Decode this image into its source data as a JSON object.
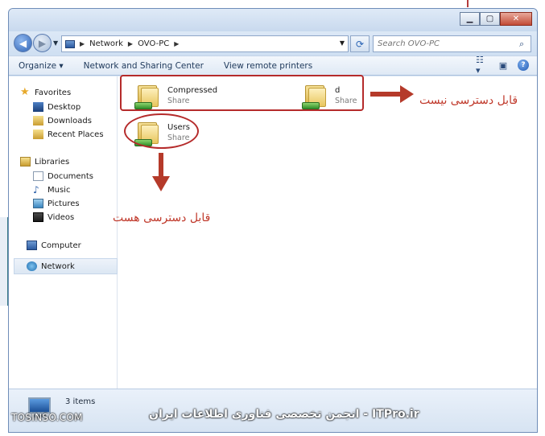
{
  "address": {
    "crumbs": [
      "Network",
      "OVO-PC"
    ]
  },
  "search": {
    "placeholder": "Search OVO-PC"
  },
  "toolbar": {
    "organize_label": "Organize ▾",
    "network_sharing_label": "Network and Sharing Center",
    "view_printers_label": "View remote printers"
  },
  "nav": {
    "favorites": {
      "label": "Favorites",
      "items": [
        "Desktop",
        "Downloads",
        "Recent Places"
      ]
    },
    "libraries": {
      "label": "Libraries",
      "items": [
        "Documents",
        "Music",
        "Pictures",
        "Videos"
      ]
    },
    "computer_label": "Computer",
    "network_label": "Network"
  },
  "shares": [
    {
      "name": "Compressed",
      "type": "Share"
    },
    {
      "name": "d",
      "type": "Share"
    },
    {
      "name": "Users",
      "type": "Share"
    }
  ],
  "status": {
    "items_count": "3 items"
  },
  "annotations": {
    "not_accessible": "قابل دسترسی نیست",
    "accessible": "قابل دسترسی هست",
    "annotation_color": "#c0392b"
  },
  "watermark": {
    "left": "TOSINSO.COM",
    "right": "ITPro.ir - انجمن تخصصی فناوری اطلاعات ایران"
  }
}
